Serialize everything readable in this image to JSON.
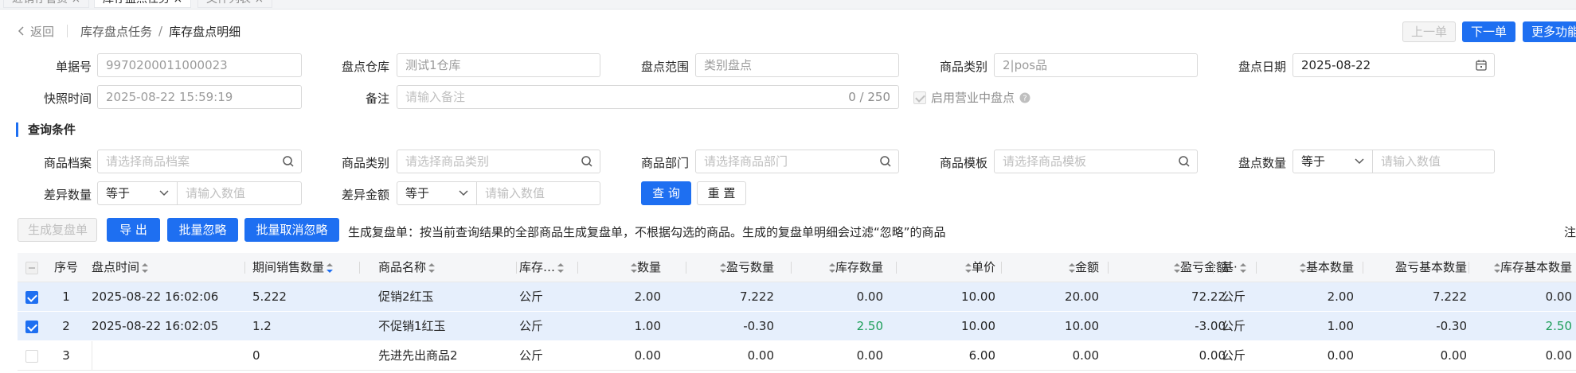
{
  "tabs": [
    {
      "label": "近销存管货 ×",
      "active": false
    },
    {
      "label": "库存盘点任务 ×",
      "active": true
    },
    {
      "label": "文件列表 ×",
      "active": false
    }
  ],
  "breadcrumb": {
    "back": "返回",
    "parent": "库存盘点任务",
    "current": "库存盘点明细"
  },
  "top_buttons": {
    "prev": "上一单",
    "next": "下一单",
    "more": "更多功能"
  },
  "header_form": {
    "doc_no": {
      "label": "单据号",
      "value": "9970200011000023"
    },
    "warehouse": {
      "label": "盘点仓库",
      "value": "测试1仓库"
    },
    "scope": {
      "label": "盘点范围",
      "value": "类别盘点"
    },
    "category": {
      "label": "商品类别",
      "value": "2|pos品"
    },
    "date": {
      "label": "盘点日期",
      "value": "2025-08-22"
    },
    "snapshot": {
      "label": "快照时间",
      "value": "2025-08-22 15:59:19"
    },
    "remark": {
      "label": "备注",
      "placeholder": "请输入备注",
      "count": "0 / 250"
    },
    "in_business": {
      "label": "启用营业中盘点"
    }
  },
  "query": {
    "title": "查询条件",
    "product": {
      "label": "商品档案",
      "placeholder": "请选择商品档案"
    },
    "category": {
      "label": "商品类别",
      "placeholder": "请选择商品类别"
    },
    "dept": {
      "label": "商品部门",
      "placeholder": "请选择商品部门"
    },
    "template": {
      "label": "商品模板",
      "placeholder": "请选择商品模板"
    },
    "count_qty": {
      "label": "盘点数量",
      "op": "等于",
      "placeholder": "请输入数值"
    },
    "diff_qty": {
      "label": "差异数量",
      "op": "等于",
      "placeholder": "请输入数值"
    },
    "diff_amt": {
      "label": "差异金额",
      "op": "等于",
      "placeholder": "请输入数值"
    },
    "search": "查 询",
    "reset": "重 置"
  },
  "actions": {
    "recheck": "生成复盘单",
    "export": "导 出",
    "batch_ignore": "批量忽略",
    "batch_unignore": "批量取消忽略",
    "hint": "生成复盘单：按当前查询结果的全部商品生成复盘单，不根据勾选的商品。生成的复盘单明细会过滤“忽略”的商品",
    "note": "注"
  },
  "table": {
    "headers": [
      "序号",
      "盘点时间",
      "期间销售数量",
      "商品名称",
      "库存…",
      "数量",
      "盈亏数量",
      "库存数量",
      "单价",
      "金额",
      "盈亏金额",
      "基·",
      "基本数量",
      "盈亏基本数量",
      "库存基本数量"
    ],
    "rows": [
      {
        "checked": true,
        "no": "1",
        "time": "2025-08-22 16:02:06",
        "sales": "5.222",
        "name": "促销2红玉",
        "unit": "公斤",
        "qty": "2.00",
        "pl_qty": "7.222",
        "stock": "0.00",
        "price": "10.00",
        "amount": "20.00",
        "pl_amt": "72.22",
        "base_unit": "公斤",
        "base_qty": "2.00",
        "pl_base": "7.222",
        "stock_base": "0.00",
        "stock_green": false
      },
      {
        "checked": true,
        "no": "2",
        "time": "2025-08-22 16:02:05",
        "sales": "1.2",
        "name": "不促销1红玉",
        "unit": "公斤",
        "qty": "1.00",
        "pl_qty": "-0.30",
        "stock": "2.50",
        "price": "10.00",
        "amount": "10.00",
        "pl_amt": "-3.00",
        "base_unit": "公斤",
        "base_qty": "1.00",
        "pl_base": "-0.30",
        "stock_base": "2.50",
        "stock_green": true
      },
      {
        "checked": false,
        "no": "3",
        "time": "",
        "sales": "0",
        "name": "先进先出商品2",
        "unit": "公斤",
        "qty": "0.00",
        "pl_qty": "0.00",
        "stock": "0.00",
        "price": "6.00",
        "amount": "0.00",
        "pl_amt": "0.00",
        "base_unit": "公斤",
        "base_qty": "0.00",
        "pl_base": "0.00",
        "stock_base": "0.00",
        "stock_green": false
      }
    ]
  },
  "colors": {
    "primary": "#1e6ff1",
    "selected_row": "#e6effc",
    "positive_green": "#1e9e5a"
  }
}
